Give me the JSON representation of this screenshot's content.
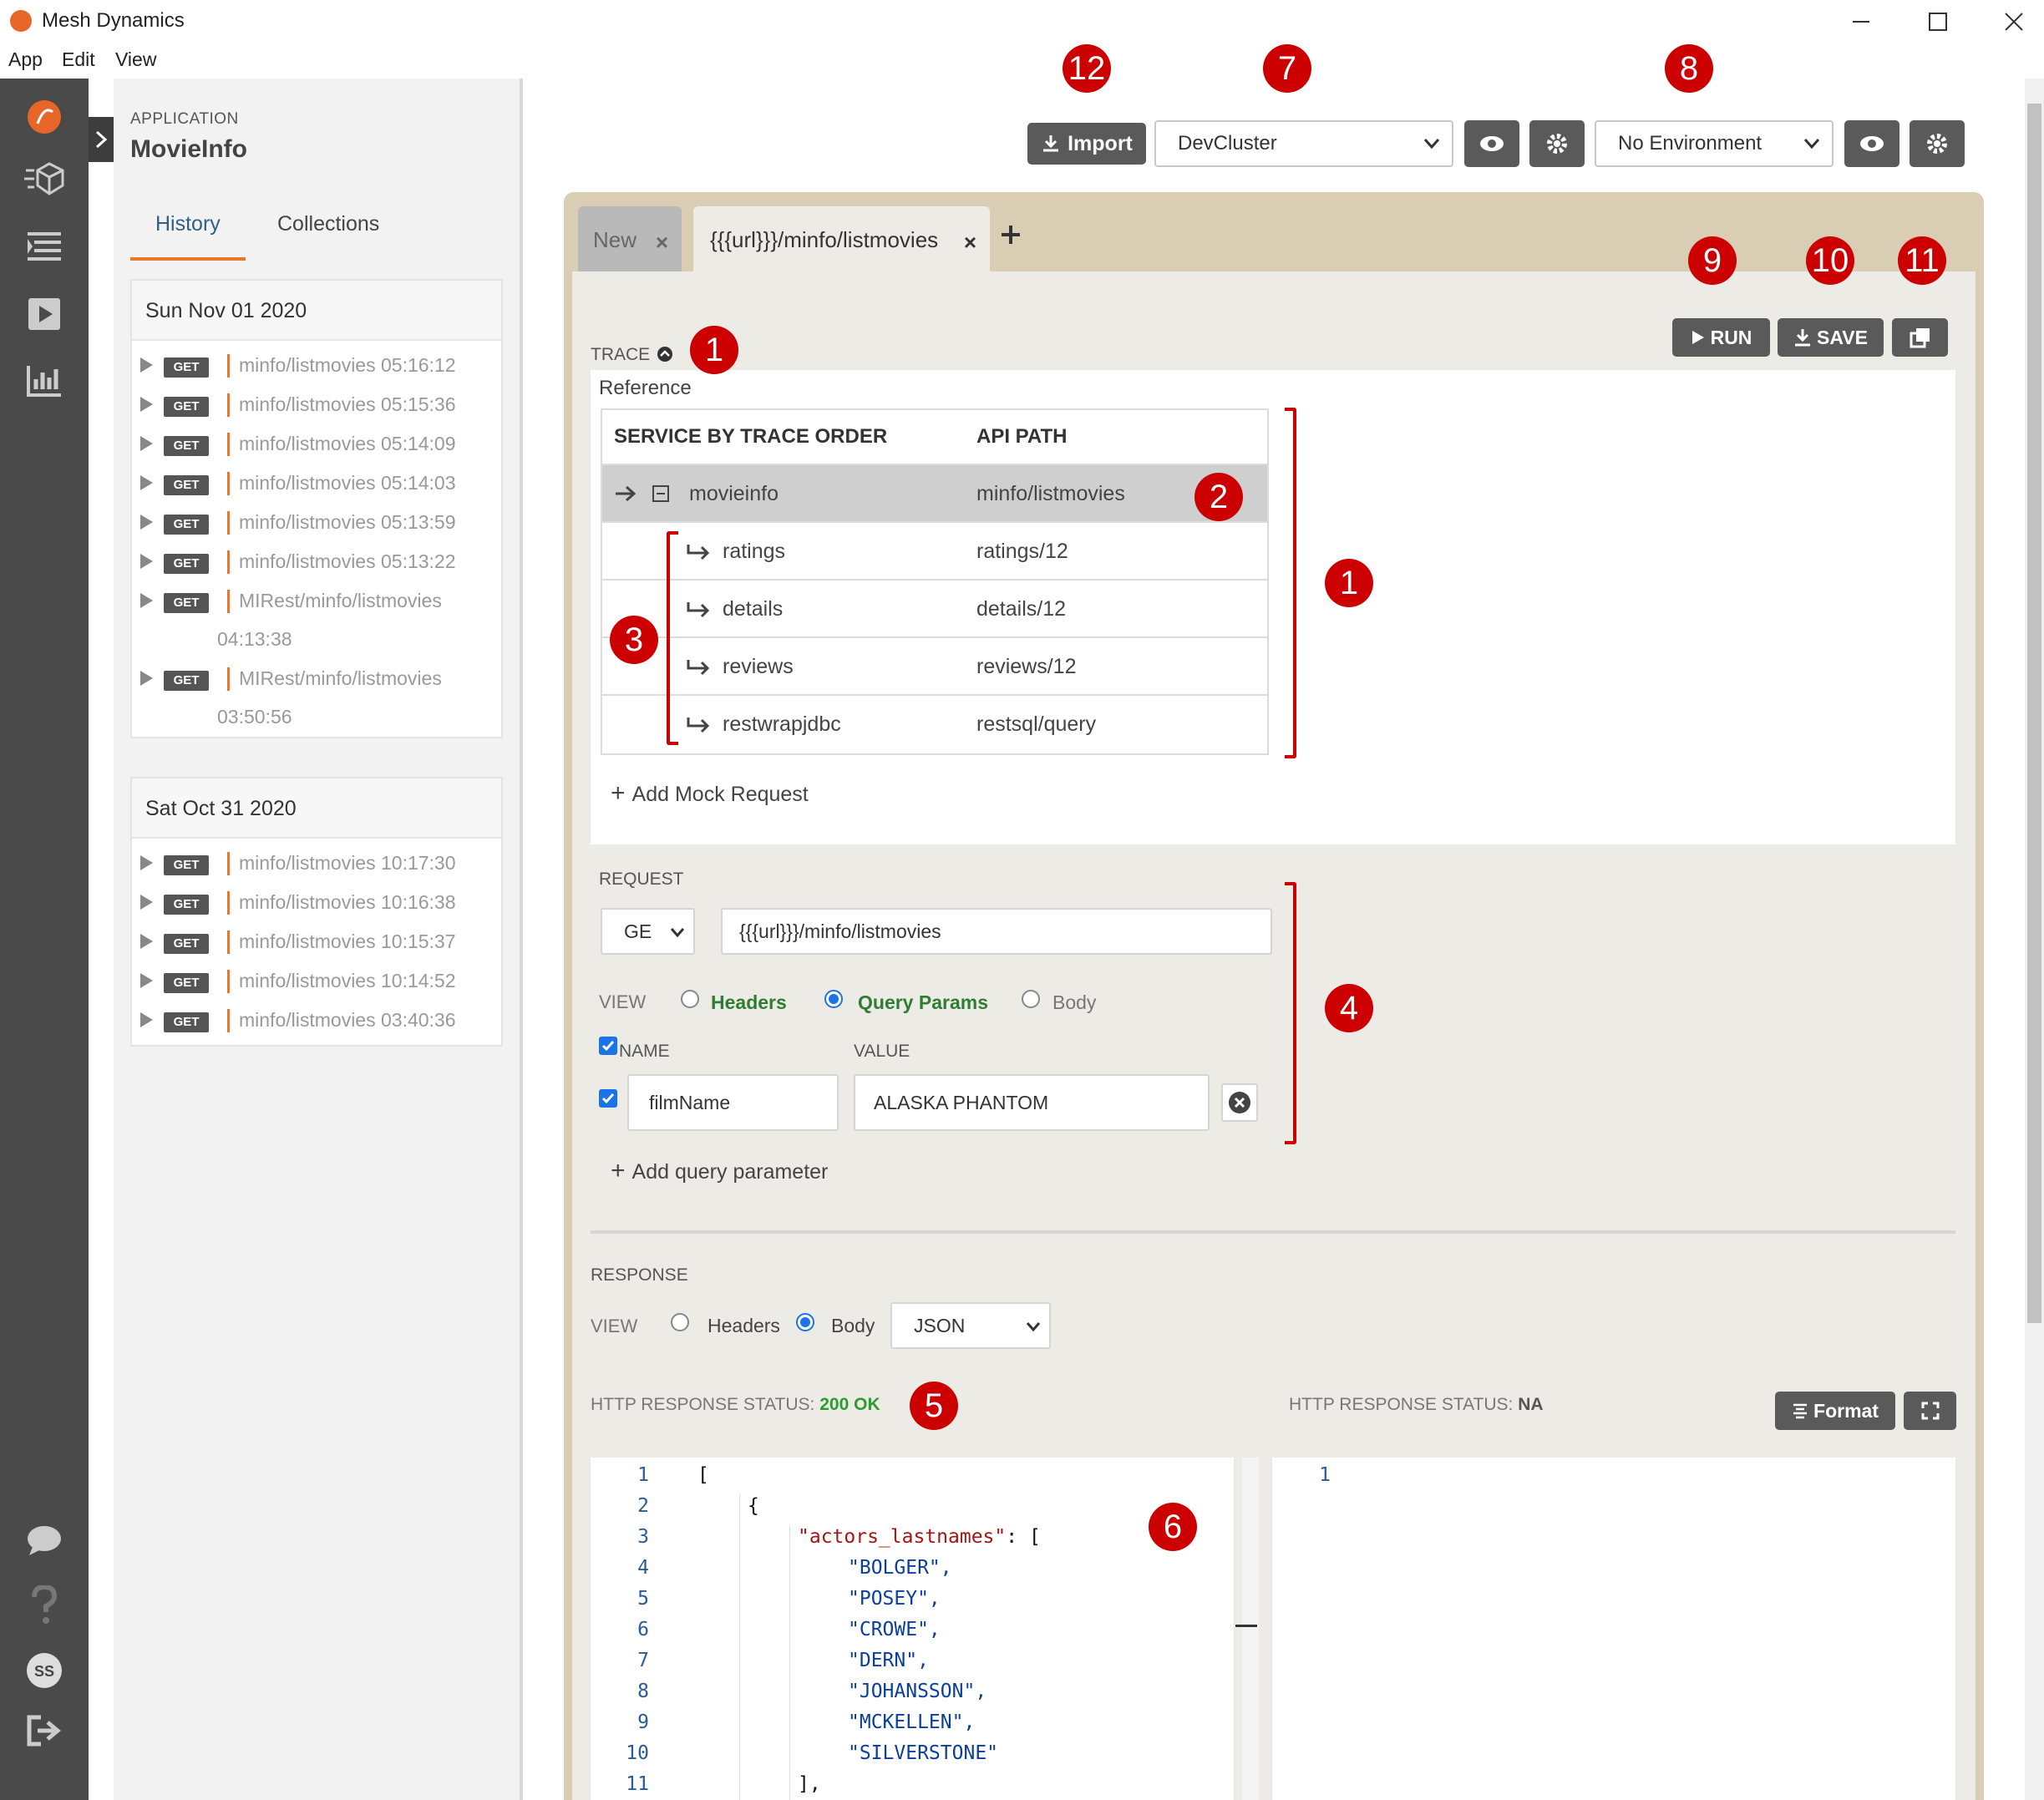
{
  "window": {
    "title": "Mesh Dynamics",
    "menu": [
      "App",
      "Edit",
      "View"
    ]
  },
  "sidebar": {
    "app_label": "APPLICATION",
    "app_name": "MovieInfo",
    "tabs": [
      "History",
      "Collections"
    ],
    "days": [
      {
        "date": "Sun Nov 01 2020",
        "items": [
          {
            "method": "GET",
            "path": "minfo/listmovies 05:16:12"
          },
          {
            "method": "GET",
            "path": "minfo/listmovies 05:15:36"
          },
          {
            "method": "GET",
            "path": "minfo/listmovies 05:14:09"
          },
          {
            "method": "GET",
            "path": "minfo/listmovies 05:14:03"
          },
          {
            "method": "GET",
            "path": "minfo/listmovies 05:13:59"
          },
          {
            "method": "GET",
            "path": "minfo/listmovies 05:13:22"
          },
          {
            "method": "GET",
            "path": "MIRest/minfo/listmovies",
            "time": "04:13:38"
          },
          {
            "method": "GET",
            "path": "MIRest/minfo/listmovies",
            "time": "03:50:56"
          }
        ]
      },
      {
        "date": "Sat Oct 31 2020",
        "items": [
          {
            "method": "GET",
            "path": "minfo/listmovies 10:17:30"
          },
          {
            "method": "GET",
            "path": "minfo/listmovies 10:16:38"
          },
          {
            "method": "GET",
            "path": "minfo/listmovies 10:15:37"
          },
          {
            "method": "GET",
            "path": "minfo/listmovies 10:14:52"
          },
          {
            "method": "GET",
            "path": "minfo/listmovies 03:40:36"
          }
        ]
      }
    ]
  },
  "toolbar": {
    "import_label": "Import",
    "cluster": "DevCluster",
    "environment": "No Environment"
  },
  "tabs": {
    "new_label": "New",
    "active_label": "{{{url}}}/minfo/listmovies"
  },
  "actions": {
    "run": "RUN",
    "save": "SAVE"
  },
  "trace": {
    "label": "TRACE",
    "reference": "Reference",
    "col_service": "SERVICE BY TRACE ORDER",
    "col_path": "API PATH",
    "rows": [
      {
        "service": "movieinfo",
        "path": "minfo/listmovies"
      },
      {
        "service": "ratings",
        "path": "ratings/12"
      },
      {
        "service": "details",
        "path": "details/12"
      },
      {
        "service": "reviews",
        "path": "reviews/12"
      },
      {
        "service": "restwrapjdbc",
        "path": "restsql/query"
      }
    ],
    "add_mock": "Add Mock Request"
  },
  "request": {
    "label": "REQUEST",
    "method": "GE",
    "url": "{{{url}}}/minfo/listmovies",
    "view_label": "VIEW",
    "views": [
      "Headers",
      "Query Params",
      "Body"
    ],
    "name_header": "NAME",
    "value_header": "VALUE",
    "param_name": "filmName",
    "param_value": "ALASKA PHANTOM",
    "add_param": "Add query parameter"
  },
  "response": {
    "label": "RESPONSE",
    "view_label": "VIEW",
    "views": [
      "Headers",
      "Body"
    ],
    "format_select": "JSON",
    "status_label": "HTTP RESPONSE STATUS:",
    "status_left": "200 OK",
    "status_right": "NA",
    "format_button": "Format",
    "code_lines": [
      "1",
      "2",
      "3",
      "4",
      "5",
      "6",
      "7",
      "8",
      "9",
      "10",
      "11"
    ],
    "code_text": {
      "l1": "[",
      "l2": "{",
      "key": "\"actors_lastnames\"",
      "l3_tail": ": [",
      "names": [
        "\"BOLGER\",",
        "\"POSEY\",",
        "\"CROWE\",",
        "\"DERN\",",
        "\"JOHANSSON\",",
        "\"MCKELLEN\",",
        "\"SILVERSTONE\""
      ],
      "l11": "],"
    },
    "right_line": "1"
  },
  "badges": [
    "12",
    "7",
    "8",
    "9",
    "10",
    "11",
    "1",
    "1",
    "2",
    "3",
    "4",
    "5",
    "6"
  ],
  "colors": {
    "accent": "#e8772a",
    "badge": "#cc0000",
    "ok": "#2e9b2e",
    "link": "#2f5f85"
  }
}
